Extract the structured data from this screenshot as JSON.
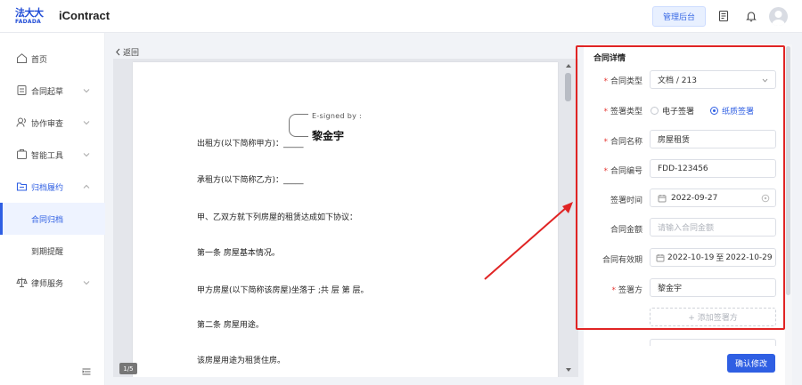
{
  "header": {
    "logo_cn": "法大大",
    "logo_en": "FADADA",
    "app_name": "iContract",
    "admin_button": "管理后台",
    "icons": [
      "document-icon",
      "bell-icon",
      "avatar"
    ]
  },
  "sidebar": {
    "items": [
      {
        "label": "首页",
        "icon": "home-icon"
      },
      {
        "label": "合同起草",
        "icon": "draft-icon"
      },
      {
        "label": "协作审查",
        "icon": "review-icon"
      },
      {
        "label": "智能工具",
        "icon": "tool-icon"
      },
      {
        "label": "归档履约",
        "icon": "folder-icon"
      },
      {
        "label": "律师服务",
        "icon": "scale-icon"
      }
    ],
    "sub_items": [
      {
        "label": "合同归档",
        "active": true
      },
      {
        "label": "到期提醒",
        "active": false
      }
    ]
  },
  "document": {
    "back_label": "返回",
    "esign_label": "E-signed by :",
    "esign_name": "黎金宇",
    "lines": [
      "出租方(以下简称甲方)：_____",
      "承租方(以下简称乙方)：_____",
      "甲、乙双方就下列房屋的租赁达成如下协议：",
      "第一条  房屋基本情况。",
      "甲方房屋(以下简称该房屋)坐落于  ;共  层  第  层。",
      "第二条  房屋用途。",
      "该房屋用途为租赁住房。"
    ],
    "page_indicator": "1/5"
  },
  "form": {
    "title": "合同详情",
    "contract_type": {
      "label": "合同类型",
      "value": "文档 / 213"
    },
    "sign_type": {
      "label": "签署类型",
      "options": [
        "电子签署",
        "纸质签署"
      ],
      "selected": "纸质签署"
    },
    "contract_name": {
      "label": "合同名称",
      "value": "房屋租赁"
    },
    "contract_number": {
      "label": "合同编号",
      "value": "FDD-123456"
    },
    "sign_date": {
      "label": "签署时间",
      "value": "2022-09-27"
    },
    "amount": {
      "label": "合同金额",
      "placeholder": "请输入合同金额"
    },
    "validity": {
      "label": "合同有效期",
      "start": "2022-10-19",
      "separator": "至",
      "end": "2022-10-29"
    },
    "signer": {
      "label": "签署方",
      "value": "黎金宇"
    },
    "add_signer": "+ 添加签署方",
    "confirm_button": "确认修改"
  },
  "colors": {
    "accent": "#2f5fe3",
    "annotation": "#e02424",
    "required": "#e53935"
  }
}
